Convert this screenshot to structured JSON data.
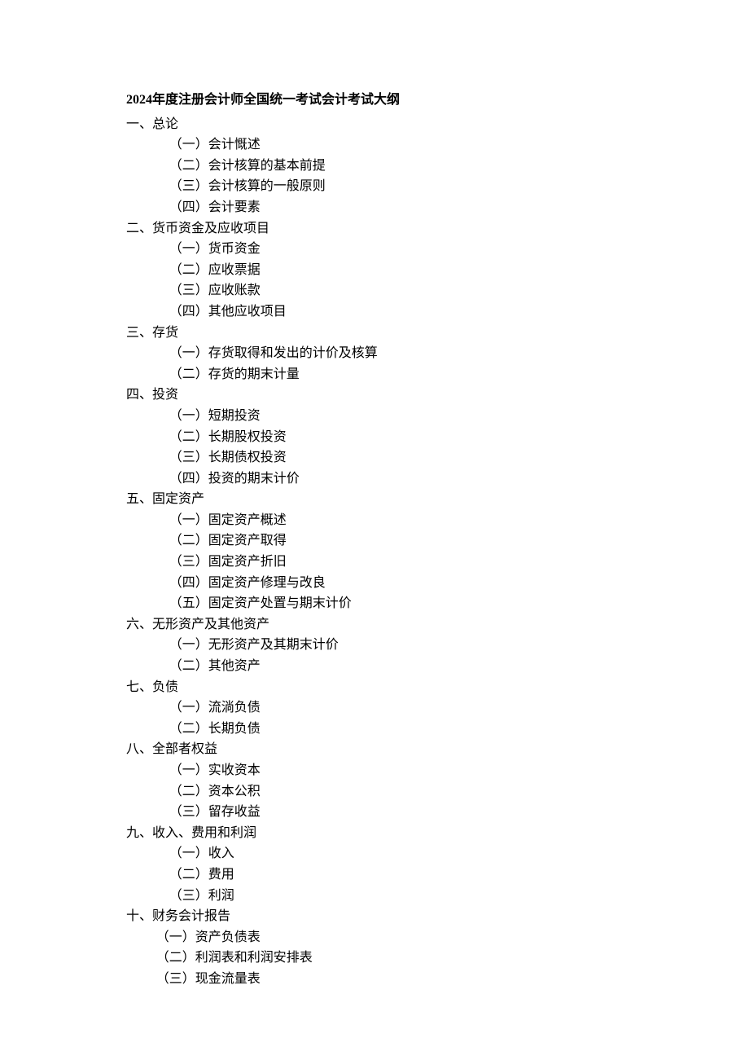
{
  "title": "2024年度注册会计师全国统一考试会计考试大纲",
  "sections": [
    {
      "head": "一、总论",
      "items": [
        "（一）会计慨述",
        "（二）会计核算的基本前提",
        "（三）会计核算的一般原则",
        "（四）会计要素"
      ]
    },
    {
      "head": "二、货币资金及应收项目",
      "items": [
        "（一）货币资金",
        "（二）应收票据",
        "（三）应收账款",
        "（四）其他应收项目"
      ]
    },
    {
      "head": "三、存货",
      "items": [
        "（一）存货取得和发出的计价及核算",
        "（二）存货的期末计量"
      ]
    },
    {
      "head": "四、投资",
      "items": [
        "（一）短期投资",
        "（二）长期股权投资",
        "（三）长期债权投资",
        "（四）投资的期末计价"
      ]
    },
    {
      "head": "五、固定资产",
      "items": [
        "（一）固定资产概述",
        "（二）固定资产取得",
        "（三）固定资产折旧",
        "（四）固定资产修理与改良",
        "（五）固定资产处置与期末计价"
      ]
    },
    {
      "head": "六、无形资产及其他资产",
      "items": [
        "（一）无形资产及其期末计价",
        "（二）其他资产"
      ]
    },
    {
      "head": "七、负债",
      "items": [
        "（一）流淌负债",
        "（二）长期负债"
      ]
    },
    {
      "head": "八、全部者权益",
      "items": [
        "（一）实收资本",
        "（二）资本公积",
        "（三）留存收益"
      ]
    },
    {
      "head": "九、收入、费用和利润",
      "items": [
        "（一）收入",
        "（二）费用",
        "（三）利润"
      ]
    },
    {
      "head": "十、财务会计报告",
      "items": [
        "（一）资产负债表",
        "（二）利润表和利润安排表",
        "（三）现金流量表"
      ],
      "indentClass": "sub-item-10"
    }
  ]
}
